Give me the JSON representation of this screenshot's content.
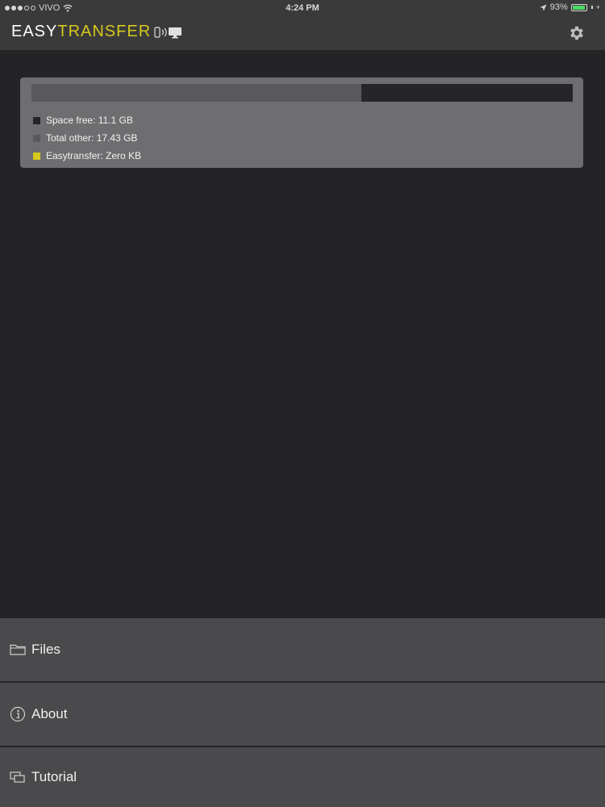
{
  "status_bar": {
    "carrier": "VIVO",
    "time": "4:24 PM",
    "battery": "93%",
    "battery_fraction": 0.93
  },
  "header": {
    "logo_part1": "EASY",
    "logo_part2": "TRANSFER",
    "settings_icon": "gear-icon"
  },
  "storage": {
    "bar": {
      "free_fraction": 0.39,
      "other_fraction": 0.61,
      "easytransfer_fraction": 0
    },
    "legend": [
      {
        "text": "Space free: 11.1 GB",
        "color": "#262527"
      },
      {
        "text": "Total other: 17.43 GB",
        "color": "#59585a"
      },
      {
        "text": "Easytransfer: Zero KB",
        "color": "#d6c81c"
      }
    ]
  },
  "menu": [
    {
      "label": "Files",
      "icon": "folder-icon"
    },
    {
      "label": "About",
      "icon": "info-icon"
    },
    {
      "label": "Tutorial",
      "icon": "tutorial-icon"
    }
  ],
  "colors": {
    "background": "#242325",
    "header": "#3a3a3b",
    "accent": "#d6c81c",
    "menu": "#4a494b"
  }
}
